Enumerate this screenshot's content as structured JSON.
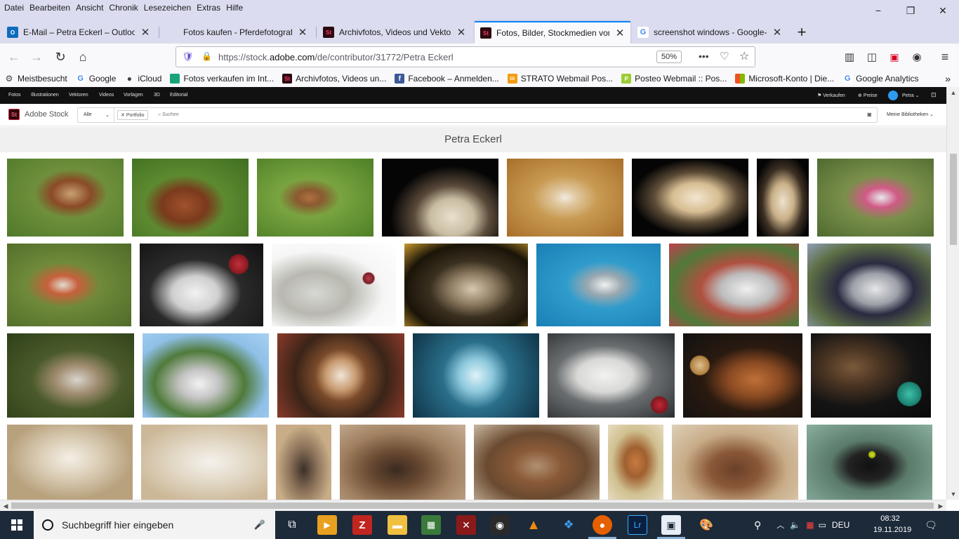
{
  "menu": {
    "items": [
      "Datei",
      "Bearbeiten",
      "Ansicht",
      "Chronik",
      "Lesezeichen",
      "Extras",
      "Hilfe"
    ]
  },
  "window_controls": {
    "minimize": "−",
    "restore": "❐",
    "close": "✕"
  },
  "tabs": [
    {
      "title": "E-Mail – Petra Eckerl – Outlook",
      "favicon": "outlook-icon",
      "color": "#0f6cbd"
    },
    {
      "title": "Fotos kaufen - Pferdefotografie",
      "favicon": "",
      "color": ""
    },
    {
      "title": "Archivfotos, Videos und Vektor",
      "favicon": "adobe-stock-icon",
      "color": "#2b0a10"
    },
    {
      "title": "Fotos, Bilder, Stockmedien von",
      "favicon": "adobe-stock-icon",
      "color": "#2b0a10"
    },
    {
      "title": "screenshot windows - Google-S",
      "favicon": "google-icon",
      "color": "#ffffff"
    }
  ],
  "nav": {
    "url_prefix": "https://stock.",
    "url_domain": "adobe.com",
    "url_path": "/de/contributor/31772/Petra Eckerl",
    "zoom": "50%"
  },
  "bookmarks": [
    {
      "label": "Meistbesucht",
      "icon": "gear-icon",
      "color": "#444444"
    },
    {
      "label": "Google",
      "icon": "google-icon",
      "color": "#ffffff"
    },
    {
      "label": "iCloud",
      "icon": "apple-icon",
      "color": "#444444"
    },
    {
      "label": "Fotos verkaufen im Int...",
      "icon": "bookmark-icon",
      "color": "#1aa37a"
    },
    {
      "label": "Archivfotos, Videos un...",
      "icon": "adobe-stock-icon",
      "color": "#2b0a10"
    },
    {
      "label": "Facebook – Anmelden...",
      "icon": "facebook-icon",
      "color": "#3b5998"
    },
    {
      "label": "STRATO Webmail Pos...",
      "icon": "mail-icon",
      "color": "#f39c12"
    },
    {
      "label": "Posteo Webmail :: Pos...",
      "icon": "posteo-icon",
      "color": "#9acd32"
    },
    {
      "label": "Microsoft-Konto | Die...",
      "icon": "microsoft-icon",
      "color": "#f25022"
    },
    {
      "label": "Google Analytics",
      "icon": "google-icon",
      "color": "#ffffff"
    }
  ],
  "stock": {
    "top_links": [
      "Fotos",
      "Illustrationen",
      "Vektoren",
      "Videos",
      "Vorlagen",
      "3D",
      "Editorial"
    ],
    "top_right": {
      "sell": "Verkaufen",
      "pricing": "Preise",
      "user": "Petra"
    },
    "brand": "Adobe Stock",
    "scope": "Alle",
    "chip": "Portfolio",
    "search_placeholder": "Suchen",
    "libraries": "Meine Bibliotheken",
    "contributor_name": "Petra Eckerl"
  },
  "taskbar": {
    "search_placeholder": "Suchbegriff hier eingeben",
    "language": "DEU",
    "time": "08:32",
    "date": "19.11.2019"
  }
}
